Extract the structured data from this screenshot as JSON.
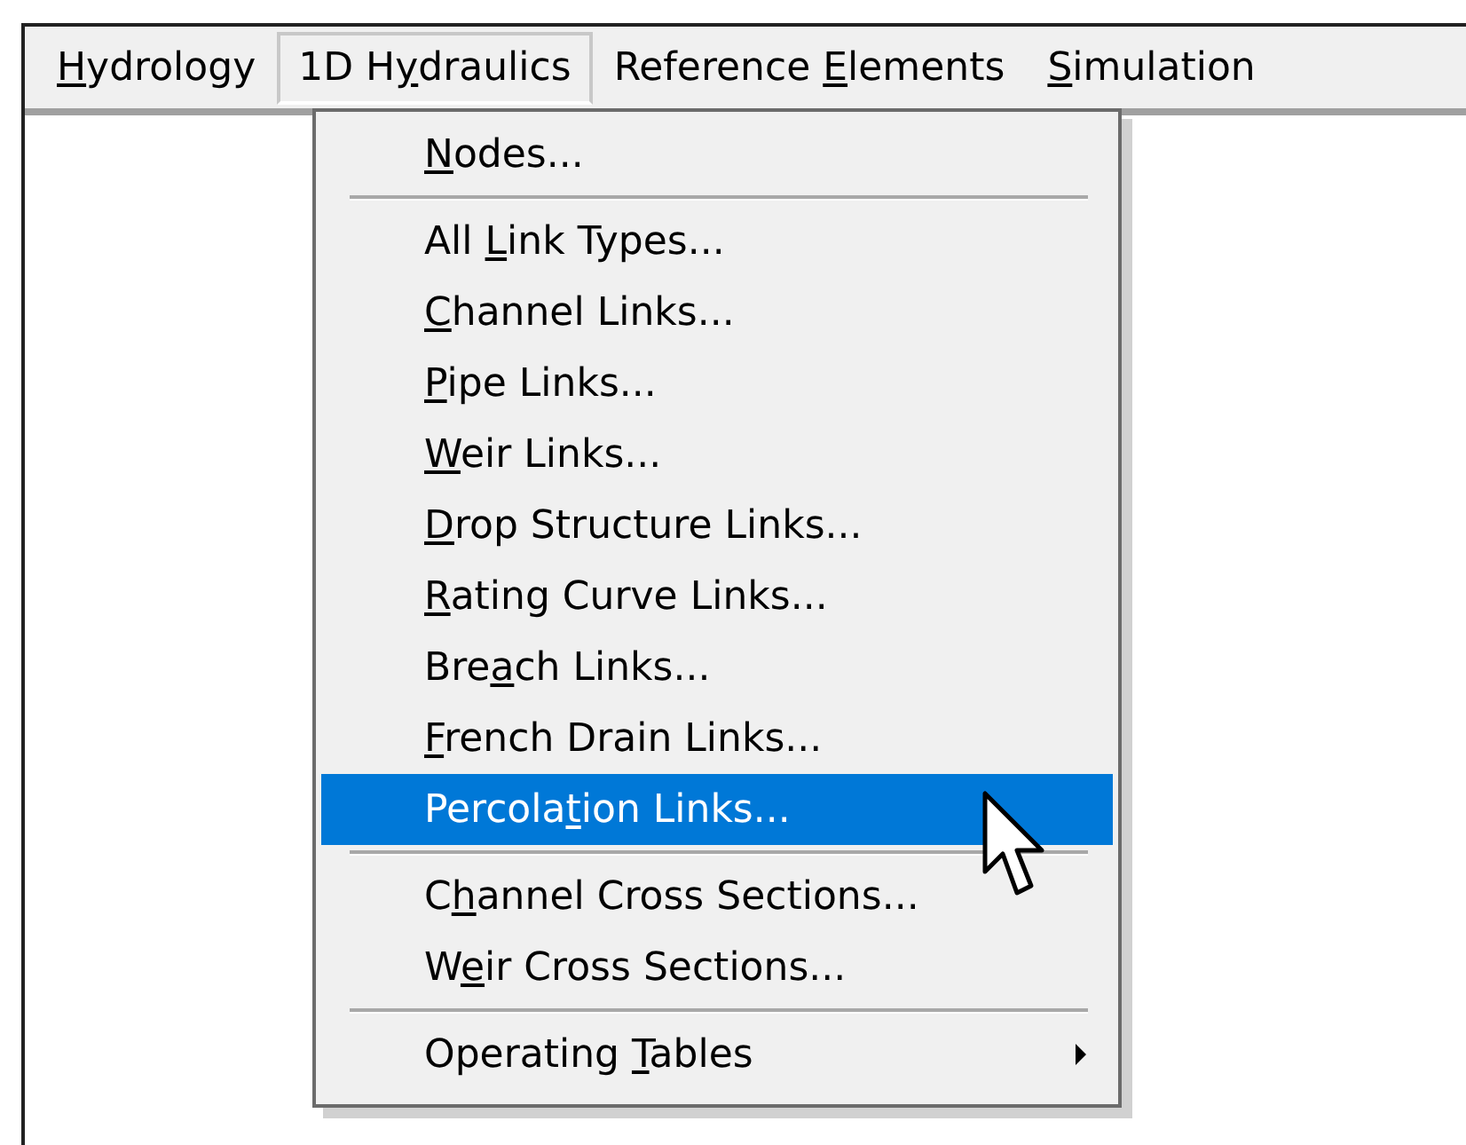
{
  "menu_bar": {
    "items": [
      {
        "access_key": "H",
        "label_after": "ydrology",
        "selected": false
      },
      {
        "label_before": "1D H",
        "access_key": "y",
        "label_after": "draulics",
        "selected": true
      },
      {
        "label_before": "Reference ",
        "access_key": "E",
        "label_after": "lements",
        "selected": false
      },
      {
        "access_key": "S",
        "label_after": "imulation",
        "selected": false
      }
    ]
  },
  "dropdown": {
    "items": [
      {
        "kind": "item",
        "access_key": "N",
        "label_after": "odes...",
        "selected": false
      },
      {
        "kind": "separator"
      },
      {
        "kind": "item",
        "label_before": "All ",
        "access_key": "L",
        "label_after": "ink Types...",
        "selected": false
      },
      {
        "kind": "item",
        "access_key": "C",
        "label_after": "hannel Links...",
        "selected": false
      },
      {
        "kind": "item",
        "access_key": "P",
        "label_after": "ipe Links...",
        "selected": false
      },
      {
        "kind": "item",
        "access_key": "W",
        "label_after": "eir Links...",
        "selected": false
      },
      {
        "kind": "item",
        "access_key": "D",
        "label_after": "rop Structure Links...",
        "selected": false
      },
      {
        "kind": "item",
        "access_key": "R",
        "label_after": "ating Curve Links...",
        "selected": false
      },
      {
        "kind": "item",
        "label_before": "Bre",
        "access_key": "a",
        "label_after": "ch Links...",
        "selected": false
      },
      {
        "kind": "item",
        "access_key": "F",
        "label_after": "rench Drain Links...",
        "selected": false
      },
      {
        "kind": "item",
        "label_before": "Percola",
        "access_key": "t",
        "label_after": "ion Links...",
        "selected": true
      },
      {
        "kind": "separator"
      },
      {
        "kind": "item",
        "label_before": "C",
        "access_key": "h",
        "label_after": "annel Cross Sections...",
        "selected": false
      },
      {
        "kind": "item",
        "label_before": "W",
        "access_key": "e",
        "label_after": "ir Cross Sections...",
        "selected": false
      },
      {
        "kind": "separator"
      },
      {
        "kind": "item",
        "label_before": "Operating ",
        "access_key": "T",
        "label_after": "ables",
        "selected": false,
        "has_submenu": true
      }
    ]
  }
}
